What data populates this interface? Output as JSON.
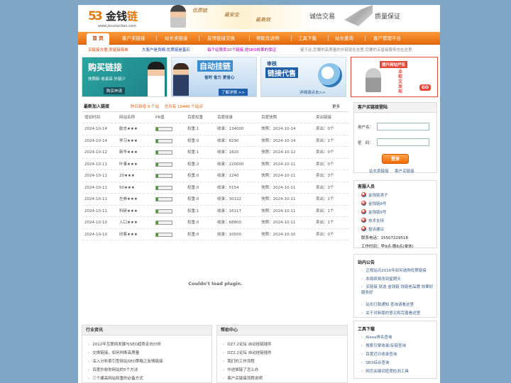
{
  "logo": {
    "mark": "53",
    "name_prefix": "金钱",
    "name_highlight": "链",
    "url": "www.jisuxianlian.com"
  },
  "banner": {
    "slogan1": "优质链",
    "slogan2": "最安全",
    "slogan3": "最高效",
    "right1": "诚信交易",
    "right2": "质量保证"
  },
  "nav": {
    "items": [
      "首 页",
      "客户买链接",
      "站长卖链接",
      "友情链接交换",
      "帮助及说明",
      "工具下载",
      "站长查询",
      "客户管理平台"
    ]
  },
  "ticker": [
    {
      "text": "买链接方便,卖链接简单",
      "color": "#d4470c"
    },
    {
      "text": "大客户是良粮,优质链是基石",
      "color": "#1a3fa8"
    },
    {
      "text": "每个站限卖10个链接,提SEO效果的保证",
      "color": "#b000b0"
    },
    {
      "text": "鉴于此,您要的高质量的外链就在这里,您要的五星级服务也在这里.",
      "color": "#888888"
    }
  ],
  "promos": [
    {
      "title": "购买链接",
      "sub1": "快照新 收录高 外链少",
      "btn": "购买申请"
    },
    {
      "title": "自动挂链",
      "sub1": "省时 省力 更省心",
      "btn": "了解详情 >>"
    },
    {
      "title": "审核",
      "title2": "链接代售",
      "btn": "详细请点击>>"
    },
    {
      "tag": "提升网站排名",
      "vert": "专业软文发布",
      "go": "GO"
    }
  ],
  "list": {
    "title": "最新加入链接",
    "stat_label": "昨日新增",
    "stat_new": "0",
    "stat_unit": "个站",
    "total_label": "总共有",
    "total": "10446",
    "total_unit": "个站点",
    "more": "更多",
    "headers": [
      "增加时间",
      "网站名称",
      "PR值",
      "百度权重",
      "百度收录",
      "百度快照",
      "卖出链接"
    ],
    "rows": [
      {
        "date": "2024-10-14",
        "name": "励志★★★",
        "pr": 0.15,
        "weight": "权重:1",
        "index": "收录：134000",
        "snap": "快照：2024-10-14",
        "sold": "卖出：0个"
      },
      {
        "date": "2024-10-14",
        "name": "学习★★★",
        "pr": 0.15,
        "weight": "权重:0",
        "index": "收录：6290",
        "snap": "快照：2024-10-14",
        "sold": "卖出：1个"
      },
      {
        "date": "2024-10-12",
        "name": "新华★★★",
        "pr": 0.15,
        "weight": "权重:1",
        "index": "收录：1820",
        "snap": "快照：2024-10-12",
        "sold": "卖出：0个"
      },
      {
        "date": "2024-10-11",
        "name": "叶事★★★",
        "pr": 0.15,
        "weight": "权重:2",
        "index": "收录：220000",
        "snap": "快照：2024-10-11",
        "sold": "卖出：0个"
      },
      {
        "date": "2024-10-11",
        "name": "20★★★",
        "pr": 0.15,
        "weight": "权重:0",
        "index": "收录：1240",
        "snap": "快照：2024-10-11",
        "sold": "卖出：3个"
      },
      {
        "date": "2024-10-11",
        "name": "50★★★",
        "pr": 0.15,
        "weight": "权重:0",
        "index": "收录：5154",
        "snap": "快照：2024-10-11",
        "sold": "卖出：3个"
      },
      {
        "date": "2024-10-11",
        "name": "左券★★★",
        "pr": 0.15,
        "weight": "权重:0",
        "index": "收录：30122",
        "snap": "快照：2024-10-11",
        "sold": "卖出：1个"
      },
      {
        "date": "2024-10-11",
        "name": "科研★★★",
        "pr": 0.15,
        "weight": "权重:1",
        "index": "收录：16117",
        "snap": "快照：2024-10-11",
        "sold": "卖出：1个"
      },
      {
        "date": "2024-10-10",
        "name": "入口★★★",
        "pr": 0.15,
        "weight": "权重:0",
        "index": "收录：68800",
        "snap": "快照：2024-10-11",
        "sold": "卖出：1个"
      },
      {
        "date": "2024-10-10",
        "name": "欣客★★★",
        "pr": 0.15,
        "weight": "权重:0",
        "index": "收录：10500",
        "snap": "快照：2024-10-10",
        "sold": "卖出：0个"
      }
    ]
  },
  "plugin": {
    "message": "Couldn't load plugin."
  },
  "industry": {
    "title": "行业资讯",
    "items": [
      "2012年互联网发展与SEO趋势走向分析",
      "交换链接，如何判断高质量",
      "深入分析索引型网站SEO策略之友情链接",
      "百度抄收你网站的5个方法",
      "三个建高网站权重的必备方式"
    ]
  },
  "help": {
    "title": "帮助中心",
    "items": [
      "DZ7.2论坛 自动挂链插件",
      "DZ2.2论坛 自动挂链插件",
      "我们的工作流程",
      "中途掉链了怎么办",
      "客户买链接流程说明"
    ]
  },
  "login": {
    "title": "客户买链接登陆",
    "user_label": "用户名：",
    "pass_label": "密　码：",
    "button": "登录",
    "link_seller": "站长卖链接",
    "link_client": "客户买链接"
  },
  "service": {
    "title": "客服人员",
    "agents": [
      "金钱链滴子",
      "金钱链8号",
      "金钱链9号",
      "技术支持",
      "投诉建议"
    ],
    "phone_label": "联系电话：",
    "phone": "15507229518",
    "hours_label": "工作时间：",
    "hours": "早9点-晚6点(单休)"
  },
  "notice": {
    "title": "站内公告",
    "items": [
      "正规站点2016年如何选购优质链接",
      "本周续费改到星期天",
      "买链接 就选 金钱链 钱链老品牌 效果好 服务好",
      "站长打款通知 查询请看这里",
      "关于对新版的意见和完善看这里"
    ]
  },
  "tools": {
    "title": "工具下载",
    "items": [
      "Alexa排名查询",
      "搜索引擎收录/反链查询",
      "百度近日收录查询",
      "SEO综合查询",
      "网页关键词密度检测工具"
    ]
  }
}
